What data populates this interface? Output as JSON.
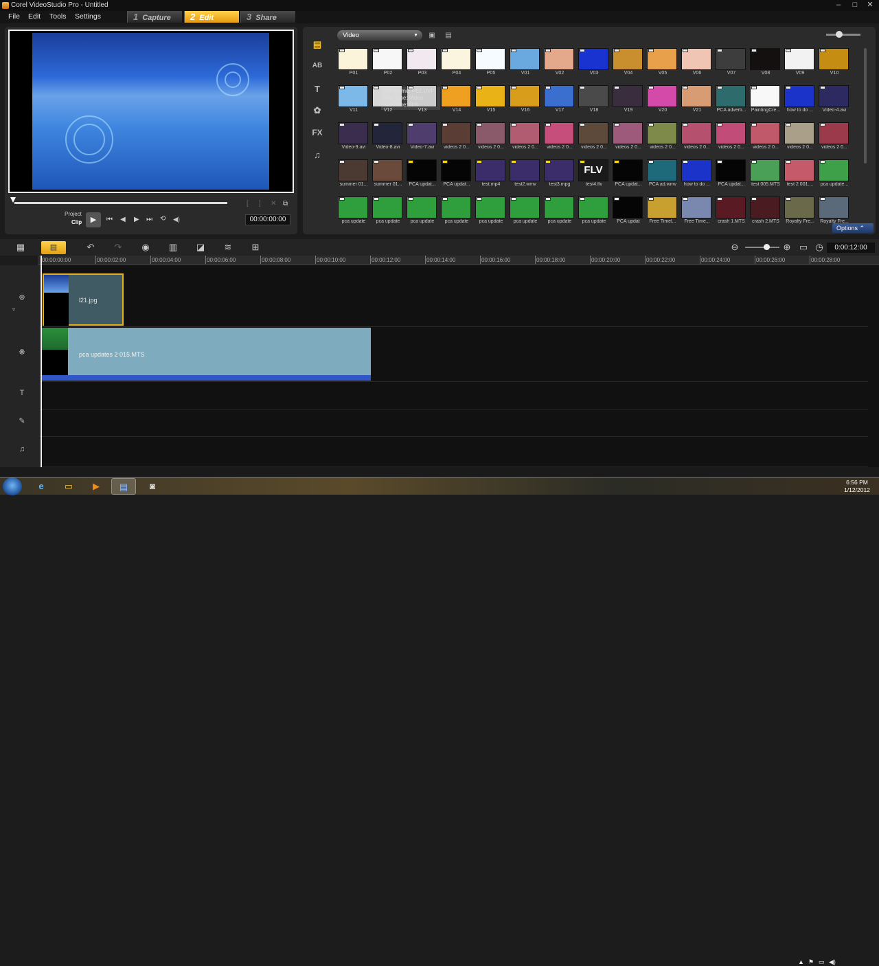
{
  "window": {
    "title": "Corel VideoStudio Pro - Untitled",
    "minimize": "–",
    "maximize": "□",
    "close": "✕"
  },
  "menu": [
    "File",
    "Edit",
    "Tools",
    "Settings"
  ],
  "steps": [
    {
      "num": "1",
      "label": "Capture"
    },
    {
      "num": "2",
      "label": "Edit"
    },
    {
      "num": "3",
      "label": "Share"
    }
  ],
  "player": {
    "project_label": "Project",
    "clip_label": "Clip",
    "timecode": "00:00:00:00",
    "play": "▶",
    "start": "⏮",
    "prev": "◀",
    "next": "▶",
    "end": "⏭",
    "repeat": "⟲",
    "volume": "◀)"
  },
  "library": {
    "selected_folder": "Video",
    "tooltip": {
      "name": "File Name: P02.UVP",
      "type": "File Type: Video",
      "time": "File Time: N/A"
    },
    "options_label": "Options",
    "thumbs": [
      {
        "label": "P01",
        "color": "#fbf4da",
        "tag": "w"
      },
      {
        "label": "P02",
        "color": "#f7f7f7",
        "tag": "w"
      },
      {
        "label": "P03",
        "color": "#f2e8f0",
        "tag": "w"
      },
      {
        "label": "P04",
        "color": "#fbf5df",
        "tag": "w"
      },
      {
        "label": "P05",
        "color": "#f5fbff",
        "tag": "w"
      },
      {
        "label": "V01",
        "color": "#6aa8e0",
        "tag": "w"
      },
      {
        "label": "V02",
        "color": "#e4a98a",
        "tag": "w"
      },
      {
        "label": "V03",
        "color": "#1833d0",
        "tag": "w"
      },
      {
        "label": "V04",
        "color": "#c98f2e",
        "tag": "w"
      },
      {
        "label": "V05",
        "color": "#e8a04a",
        "tag": "w"
      },
      {
        "label": "V06",
        "color": "#f1c5b4",
        "tag": "w"
      },
      {
        "label": "V07",
        "color": "#3d3d3d",
        "tag": "w"
      },
      {
        "label": "V08",
        "color": "#151010",
        "tag": "w"
      },
      {
        "label": "V09",
        "color": "#f2f2f2",
        "tag": "w"
      },
      {
        "label": "V10",
        "color": "#c58d12",
        "tag": "w"
      },
      {
        "label": "V11",
        "color": "#7db9e8",
        "tag": "w"
      },
      {
        "label": "V12",
        "color": "#d7d7d7",
        "tag": "w"
      },
      {
        "label": "V13",
        "color": "#c8c8c8",
        "tag": "w"
      },
      {
        "label": "V14",
        "color": "#f0a020",
        "tag": "w"
      },
      {
        "label": "V15",
        "color": "#e9b318",
        "tag": "w"
      },
      {
        "label": "V16",
        "color": "#d89d1a",
        "tag": "w"
      },
      {
        "label": "V17",
        "color": "#3a6fd0",
        "tag": "w"
      },
      {
        "label": "V18",
        "color": "#4a4a4a",
        "tag": "w"
      },
      {
        "label": "V19",
        "color": "#3a2e3e",
        "tag": "w"
      },
      {
        "label": "V20",
        "color": "#d44aa8",
        "tag": "w"
      },
      {
        "label": "V21",
        "color": "#d89c74",
        "tag": "w"
      },
      {
        "label": "PCA adverti...",
        "color": "#2d6b6c",
        "tag": "w"
      },
      {
        "label": "PaintingCre...",
        "color": "#f8f8f8",
        "tag": "w"
      },
      {
        "label": "how to do ...",
        "color": "#1b33c8",
        "tag": "w"
      },
      {
        "label": "Video-4.avi",
        "color": "#2d2a62",
        "tag": "w"
      },
      {
        "label": "Video-9.avi",
        "color": "#3b2d4e",
        "tag": "w"
      },
      {
        "label": "Video-8.avi",
        "color": "#23263a",
        "tag": "w"
      },
      {
        "label": "Video-7.avi",
        "color": "#4f3d6e",
        "tag": "w"
      },
      {
        "label": "videos 2 0...",
        "color": "#5a3d35",
        "tag": "w"
      },
      {
        "label": "videos 2 0...",
        "color": "#8b5a6a",
        "tag": "w"
      },
      {
        "label": "videos 2 0...",
        "color": "#b25c72",
        "tag": "w"
      },
      {
        "label": "videos 2 0...",
        "color": "#c54f7a",
        "tag": "w"
      },
      {
        "label": "videos 2 0...",
        "color": "#5d4a3a",
        "tag": "w"
      },
      {
        "label": "videos 2 0...",
        "color": "#9e5a7a",
        "tag": "w"
      },
      {
        "label": "videos 2 0...",
        "color": "#7e8a4a",
        "tag": "w"
      },
      {
        "label": "videos 2 0...",
        "color": "#b5506e",
        "tag": "w"
      },
      {
        "label": "videos 2 0...",
        "color": "#c24c78",
        "tag": "w"
      },
      {
        "label": "videos 2 0...",
        "color": "#c05a6a",
        "tag": "w"
      },
      {
        "label": "videos 2 0...",
        "color": "#aaa08a",
        "tag": "w"
      },
      {
        "label": "videos 2 0...",
        "color": "#9a3a4a",
        "tag": "w"
      },
      {
        "label": "summer 01...",
        "color": "#4a3a32",
        "tag": "w"
      },
      {
        "label": "summer 01...",
        "color": "#6a4a3a",
        "tag": "w"
      },
      {
        "label": "PCA updat...",
        "color": "#050505",
        "tag": "y"
      },
      {
        "label": "PCA updat...",
        "color": "#050505",
        "tag": "y"
      },
      {
        "label": "test.mp4",
        "color": "#3a2d6a",
        "tag": "y"
      },
      {
        "label": "test2.wmv",
        "color": "#3a2d6a",
        "tag": "y"
      },
      {
        "label": "test3.mpg",
        "color": "#3a2d6a",
        "tag": "y"
      },
      {
        "label": "test4.flv",
        "color": "#1a1a1a",
        "tag": "y",
        "text": "FLV"
      },
      {
        "label": "PCA updat...",
        "color": "#050505",
        "tag": "y"
      },
      {
        "label": "PCA ad.wmv",
        "color": "#1f6a7a",
        "tag": "w"
      },
      {
        "label": "how to do ...",
        "color": "#1b33c8",
        "tag": "w"
      },
      {
        "label": "PCA updat...",
        "color": "#050505",
        "tag": "w"
      },
      {
        "label": "test 005.MTS",
        "color": "#4aa056",
        "tag": "w"
      },
      {
        "label": "test 2 001....",
        "color": "#c45a6a",
        "tag": "w"
      },
      {
        "label": "pca update...",
        "color": "#3fa04a",
        "tag": "w"
      },
      {
        "label": "pca update",
        "color": "#2f9e3c",
        "tag": "w"
      },
      {
        "label": "pca update",
        "color": "#2f9e3c",
        "tag": "w"
      },
      {
        "label": "pca update",
        "color": "#2f9e3c",
        "tag": "w"
      },
      {
        "label": "pca update",
        "color": "#2f9e3c",
        "tag": "w"
      },
      {
        "label": "pca update",
        "color": "#2f9e3c",
        "tag": "w"
      },
      {
        "label": "pca update",
        "color": "#2f9e3c",
        "tag": "w"
      },
      {
        "label": "pca update",
        "color": "#2f9e3c",
        "tag": "w"
      },
      {
        "label": "pca update",
        "color": "#2f9e3c",
        "tag": "w"
      },
      {
        "label": "PCA updat",
        "color": "#050505",
        "tag": "w"
      },
      {
        "label": "Free Timel...",
        "color": "#c8a030",
        "tag": "w"
      },
      {
        "label": "Free Time...",
        "color": "#7a88b0",
        "tag": "w"
      },
      {
        "label": "crash 1.MTS",
        "color": "#5a1a24",
        "tag": "w"
      },
      {
        "label": "crash 2.MTS",
        "color": "#4a1c22",
        "tag": "w"
      },
      {
        "label": "Royalty Fre...",
        "color": "#6a6a4a",
        "tag": "w"
      },
      {
        "label": "Royalty Fre...",
        "color": "#5a6a7a",
        "tag": "w"
      }
    ]
  },
  "timeline": {
    "time": "0:00:12:00",
    "ticks": [
      "00:00:00:00",
      "00:00:02:00",
      "00:00:04:00",
      "00:00:06:00",
      "00:00:08:00",
      "00:00:10:00",
      "00:00:12:00",
      "00:00:14:00",
      "00:00:16:00",
      "00:00:18:00",
      "00:00:20:00",
      "00:00:22:00",
      "00:00:24:00",
      "00:00:26:00",
      "00:00:28:00"
    ],
    "video_clip": "l21.jpg",
    "overlay_clip": "pca updates 2 015.MTS"
  },
  "taskbar": {
    "time": "6:56 PM",
    "date": "1/12/2012"
  }
}
